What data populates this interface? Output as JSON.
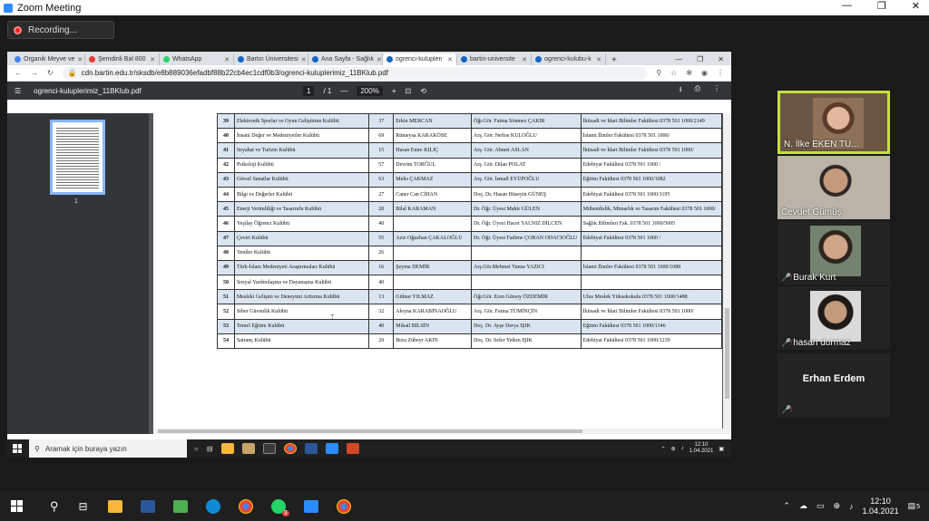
{
  "zoom": {
    "title": "Zoom Meeting",
    "recording_label": "Recording...",
    "window_controls": [
      "—",
      "❐",
      "✕"
    ]
  },
  "browser": {
    "tabs": [
      {
        "label": "Organik Meyve ve",
        "color": "#4285f4"
      },
      {
        "label": "Şemdinli Bal 800",
        "color": "#e53935"
      },
      {
        "label": "WhatsApp",
        "color": "#25d366"
      },
      {
        "label": "Bartın Üniversitesi",
        "color": "#1565c0"
      },
      {
        "label": "Ana Sayfa - Sağlık",
        "color": "#1565c0"
      },
      {
        "label": "ogrenci-kuluplen",
        "color": "#1565c0",
        "active": true
      },
      {
        "label": "bartin-universite",
        "color": "#1565c0"
      },
      {
        "label": "ogrenci-kulubu-k",
        "color": "#1565c0"
      }
    ],
    "url": "cdn.bartin.edu.tr/sksdb/e8b889036efadbf88b22cb4ec1cdf0b3/ogrenci-kuluplerimiz_11BKlub.pdf"
  },
  "pdf": {
    "filename": "ogrenci-kuluplerimiz_11BKlub.pdf",
    "page_current": "1",
    "page_total": "/ 1",
    "zoom": "200%",
    "thumbnail_page": "1",
    "rows": [
      [
        "39",
        "Elektronik Sporlar ve Oyun Geliştirme Kulübü",
        "37",
        "Erkin MERCAN",
        "Öğr.Gör. Fatma Sönmez ÇAKIR",
        "İktisadi ve İdari Bilimler Fakültesi 0378 501 1000/2149"
      ],
      [
        "40",
        "İnsani Değer ve Medeniyetler Kulübü",
        "69",
        "Rümeysa KARAKÖSE",
        "Arş. Gör. Nefise KULOĞLU",
        "İslami İlimler Fakültesi 0378 501 1000/"
      ],
      [
        "41",
        "Seyahat ve Turizm Kulübü",
        "15",
        "Hasan Emre KILIÇ",
        "Arş. Gör. Ahmet ASLAN",
        "İktisadi ve İdari Bilimler Fakültesi 0378 501 1000/"
      ],
      [
        "42",
        "Psikoloji Kulübü",
        "57",
        "Devrim TORĞUL",
        "Arş. Gör. Dilan POLAT",
        "Edebiyat Fakültesi 0378 501 1000 /"
      ],
      [
        "43",
        "Görsel Sanatlar Kulübü",
        "63",
        "Melis ÇAKMAZ",
        "Arş. Gör. İsmail EYÜPOĞLU",
        "Eğitim Fakültesi 0378 501 1000/1082"
      ],
      [
        "44",
        "Bilgi ve Değerler Kulübü",
        "27",
        "Caner Can CİHAN",
        "Doç. Dr. Hasan Hüseyin GÜNEŞ",
        "Edebiyat Fakültesi 0378 501 1000/1195"
      ],
      [
        "45",
        "Enerji Verimliliği ve Tasarrufu Kulübü",
        "20",
        "Bilal KARAMAN",
        "Dr. Öğr. Üyesi Mahir GÜLEN",
        "Mühendislik, Mimarlık ve Tasarım Fakültesi 0378 501 1000/"
      ],
      [
        "46",
        "Yeşilay Öğrenci Kulübü",
        "40",
        "",
        "Dr. Öğr. Üyesi Hacer YALNIZ DİLCEN",
        "Sağlık Bilimleri Fak. 0378 501 1000/5005"
      ],
      [
        "47",
        "Çeviri Kulübü",
        "55",
        "Aziz Oğuzhan ÇAKALOĞLU",
        "Dr. Öğr. Üyesi Fadime ÇOBAN ODACIOĞLU",
        "Edebiyat Fakültesi 0378 501 1000 /"
      ],
      [
        "48",
        "Yeniler Kulübü",
        "26",
        "",
        "",
        ""
      ],
      [
        "49",
        "Türk-İslam Medeniyeti Araştırmaları Kulübü",
        "16",
        "Şeyma DEMİR",
        "Arş.Gör.Mehmet Yunus YAZICI",
        "İslami İlimler Fakültesi 0378 501 1000/1088"
      ],
      [
        "50",
        "Sosyal Yardımlaşma ve Dayanışma Kulübü",
        "40",
        "",
        "",
        ""
      ],
      [
        "51",
        "Mesleki Gelişim ve Deneyimi Arttırma Kulübü",
        "13",
        "Gülnur YILMAZ",
        "Öğr.Gör. Eren Gürsoy ÖZDEMİR",
        "Ulus Meslek Yüksekokulu 0378 501 1000/1488"
      ],
      [
        "52",
        "Siber Güvenlik Kulübü",
        "32",
        "Aleyna KARABİNAOĞLU",
        "Arş. Gör. Fatma TÜMİNÇİN",
        "İktisadi ve İdari Bilimler Fakültesi 0378 501 1000/"
      ],
      [
        "53",
        "Temel Eğitim Kulübü",
        "40",
        "Mikail BİLSİN",
        "Doç. Dr. Ayşe Derya IŞIK",
        "Eğitim Fakültesi 0378 501 1000/1346"
      ],
      [
        "54",
        "Satranç Kulübü",
        "20",
        "Bora Zübeyr AKIN",
        "Doç. Dr. Sefer Yetkin IŞIK",
        "Edebiyat Fakültesi 0378 501 1000/1239"
      ]
    ]
  },
  "inner_taskbar": {
    "search_placeholder": "Aramak için buraya yazın",
    "time": "12:10",
    "date": "1.04.2021"
  },
  "participants": [
    {
      "name": "N. İlke EKEN TU...",
      "muted": false,
      "has_video": true,
      "active_speaker": true
    },
    {
      "name": "Cevdet Gümüş",
      "muted": false,
      "has_video": true
    },
    {
      "name": "Burak Kurt",
      "muted": true,
      "has_video": true
    },
    {
      "name": "hasan durmaz",
      "muted": true,
      "has_video": true
    },
    {
      "name": "Erhan Erdem",
      "muted": true,
      "has_video": false
    }
  ],
  "windows_taskbar": {
    "time": "12:10",
    "date": "1.04.2021",
    "notification_count": "5",
    "whatsapp_badge": "3"
  }
}
